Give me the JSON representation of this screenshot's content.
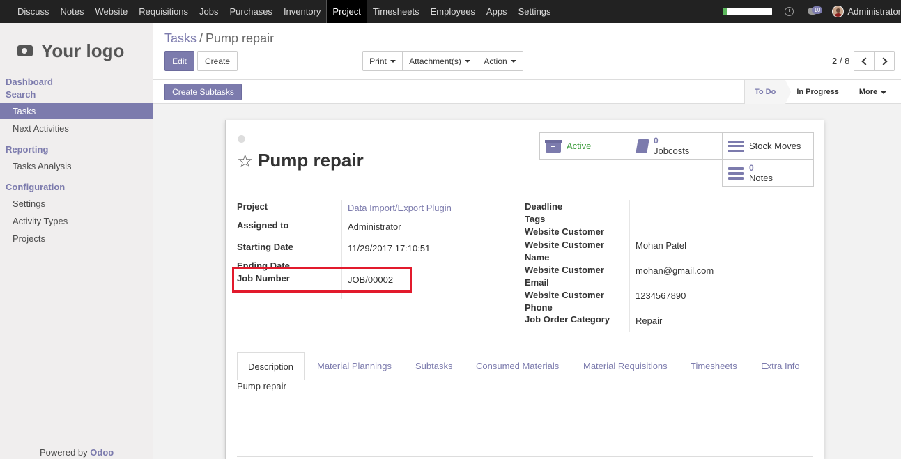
{
  "topbar": {
    "menu": [
      "Discuss",
      "Notes",
      "Website",
      "Requisitions",
      "Jobs",
      "Purchases",
      "Inventory",
      "Project",
      "Timesheets",
      "Employees",
      "Apps",
      "Settings"
    ],
    "active_menu": "Project",
    "progress_fraction": 0.08,
    "chat_badge": "10",
    "username": "Administrator"
  },
  "sidebar": {
    "logo_text": "Your logo",
    "sections": [
      {
        "title": "Dashboard",
        "items": []
      },
      {
        "title": "Search",
        "items": [
          "Tasks",
          "Next Activities"
        ]
      },
      {
        "title": "Reporting",
        "items": [
          "Tasks Analysis"
        ]
      },
      {
        "title": "Configuration",
        "items": [
          "Settings",
          "Activity Types",
          "Projects"
        ]
      }
    ],
    "active_item": "Tasks",
    "powered_by": "Powered by",
    "powered_brand": "Odoo"
  },
  "control": {
    "breadcrumb_parent": "Tasks",
    "breadcrumb_sep": "/",
    "breadcrumb_current": "Pump repair",
    "edit_label": "Edit",
    "create_label": "Create",
    "print_label": "Print",
    "attachment_label": "Attachment(s)",
    "action_label": "Action",
    "pager": "2 / 8"
  },
  "statusbar": {
    "create_subtasks_label": "Create Subtasks",
    "stages": [
      "To Do",
      "In Progress"
    ],
    "current_stage": "To Do",
    "more_label": "More"
  },
  "sheet": {
    "title": "Pump repair",
    "smart_buttons": {
      "active": "Active",
      "jobcosts_count": "0",
      "jobcosts_label": "Jobcosts",
      "stock_moves": "Stock Moves",
      "notes_count": "0",
      "notes_label": "Notes"
    },
    "left_fields": [
      {
        "label": "Project",
        "value": "Data Import/Export Plugin"
      },
      {
        "label": "Assigned to",
        "value": "Administrator"
      },
      {
        "label": "Starting Date",
        "value": "11/29/2017 17:10:51"
      },
      {
        "label": "Ending Date",
        "value": ""
      },
      {
        "label": "Job Number",
        "value": "JOB/00002"
      }
    ],
    "right_fields": [
      {
        "label": "Deadline",
        "value": ""
      },
      {
        "label": "Tags",
        "value": ""
      },
      {
        "label": "Website Customer",
        "value": ""
      },
      {
        "label": "Website Customer Name",
        "value": "Mohan Patel"
      },
      {
        "label": "Website Customer Email",
        "value": "mohan@gmail.com"
      },
      {
        "label": "Website Customer Phone",
        "value": "1234567890"
      },
      {
        "label": "Job Order Category",
        "value": "Repair"
      }
    ],
    "tabs": [
      "Description",
      "Material Plannings",
      "Subtasks",
      "Consumed Materials",
      "Material Requisitions",
      "Timesheets",
      "Extra Info"
    ],
    "active_tab": "Description",
    "description": "Pump repair"
  },
  "colors": {
    "accent": "#7c7bad",
    "topbar": "#222222",
    "highlight": "#e21a2c"
  }
}
